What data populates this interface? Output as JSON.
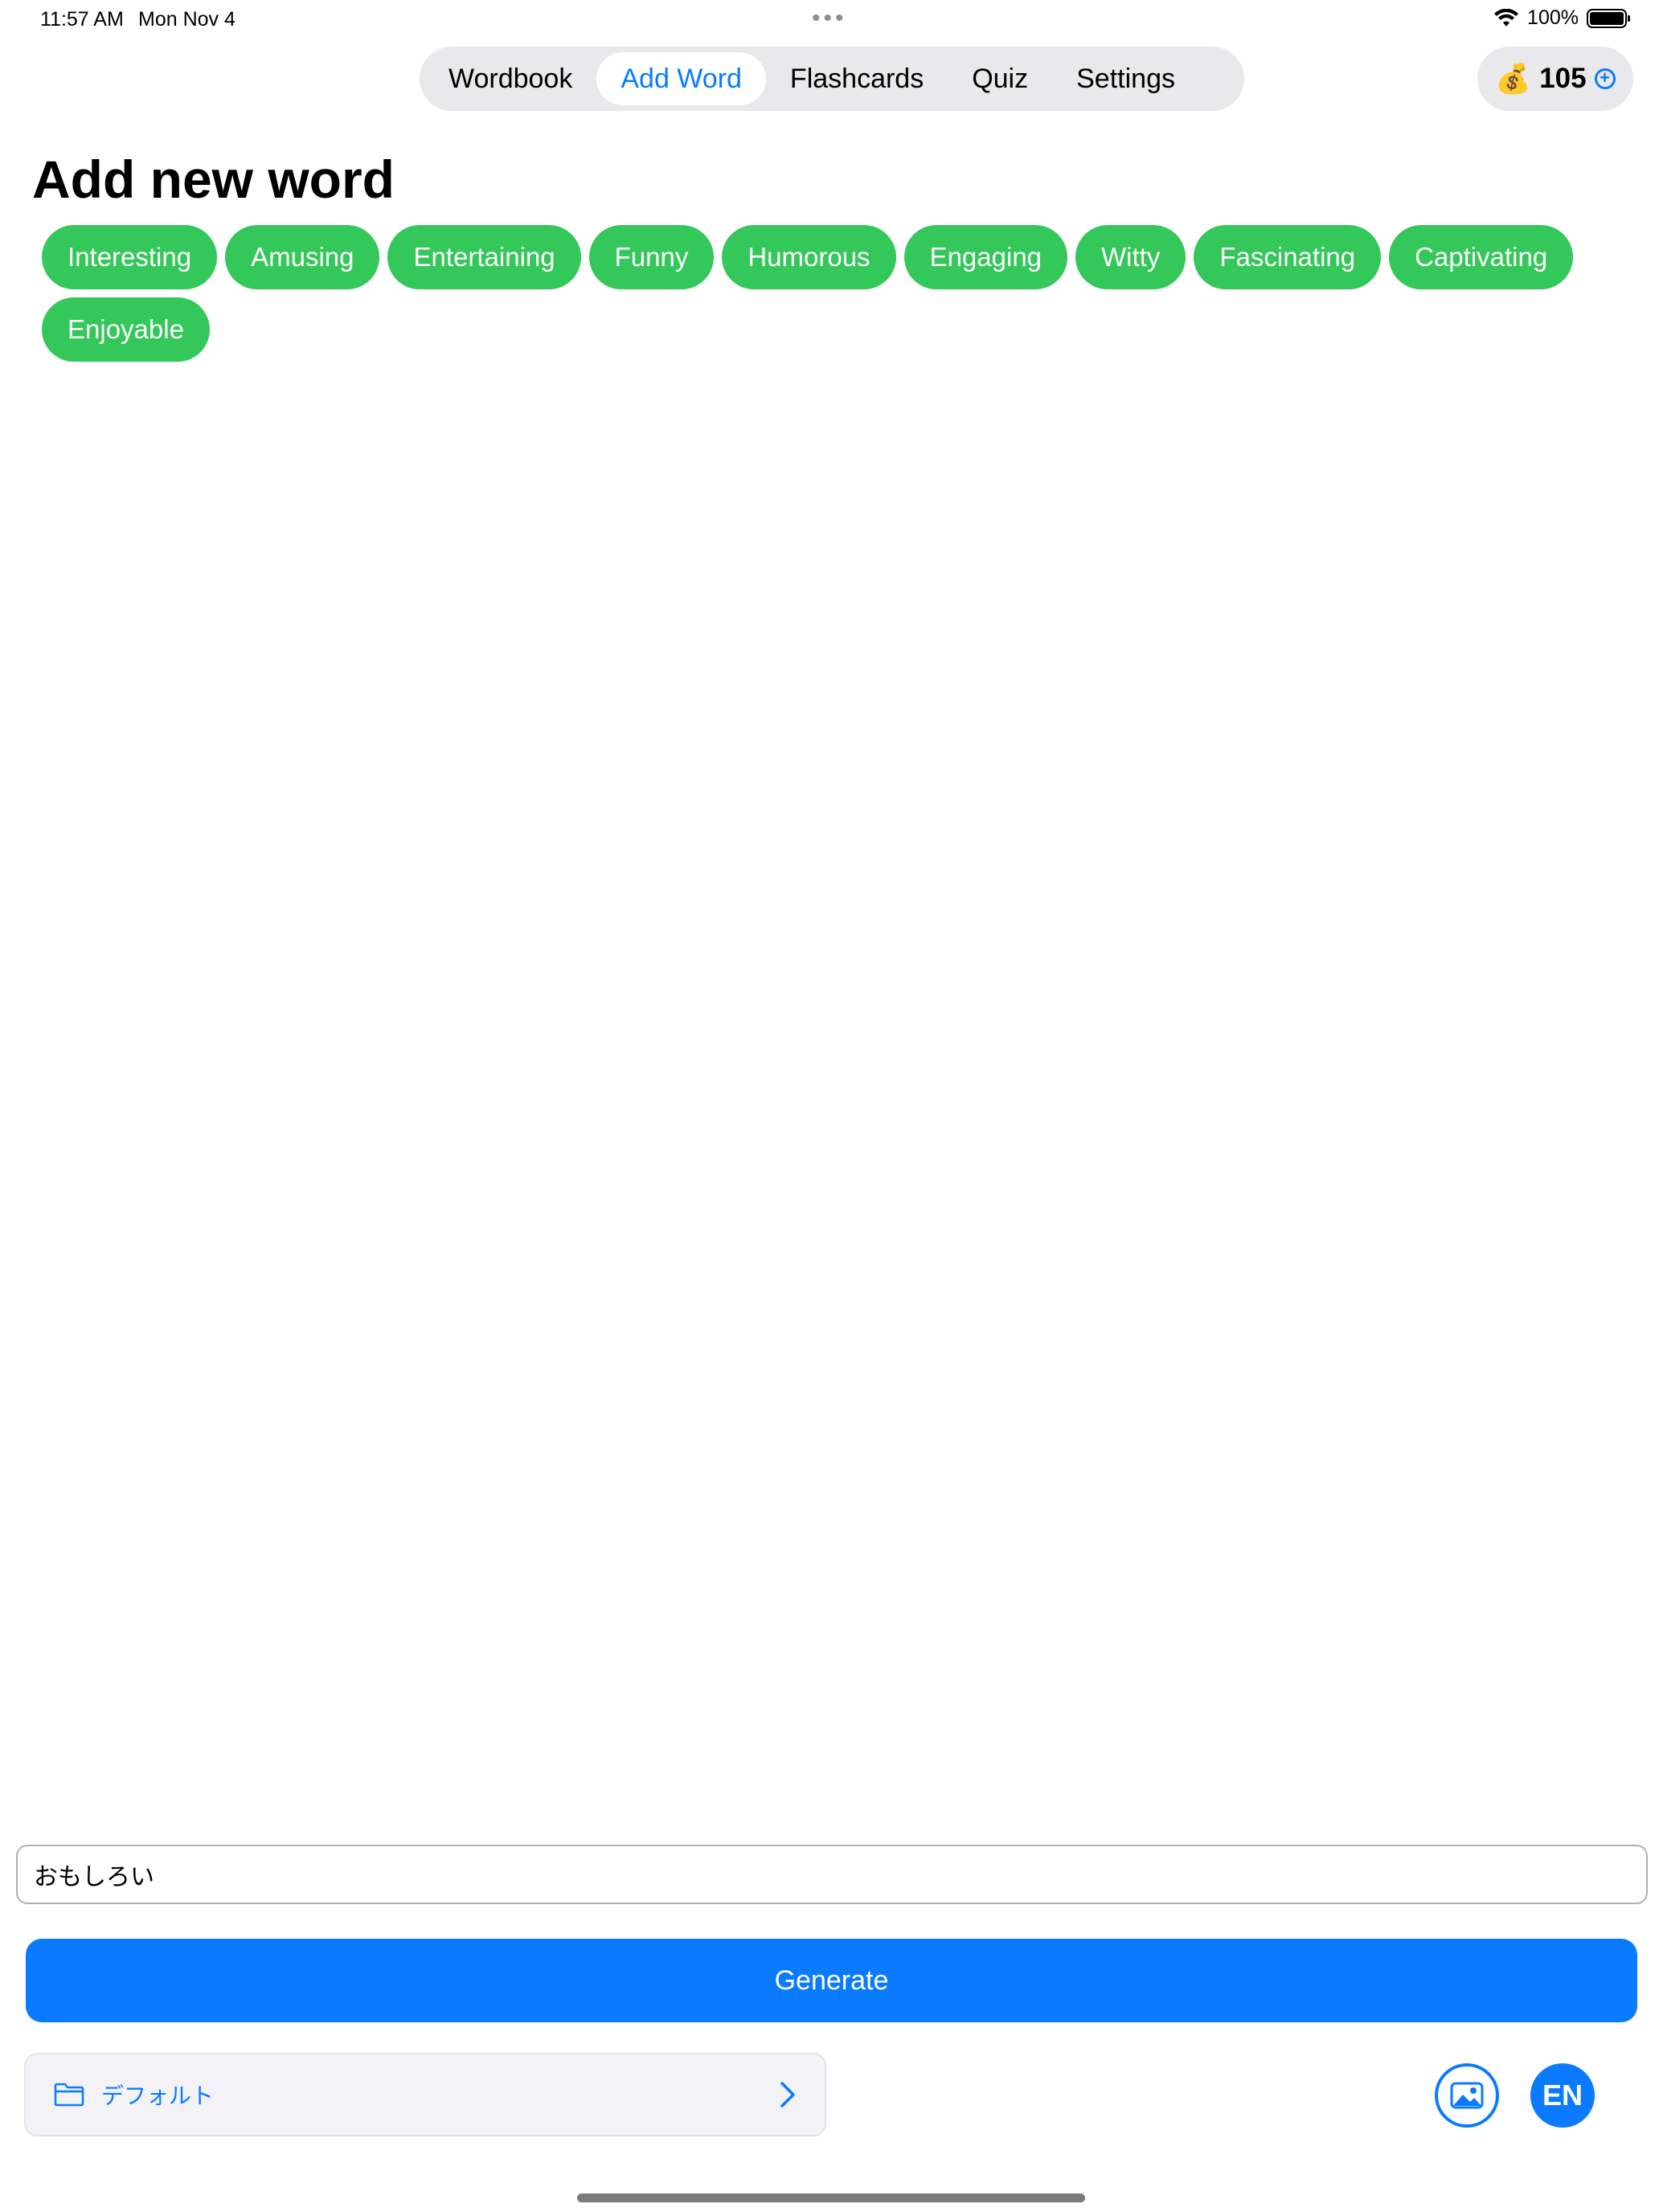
{
  "status_bar": {
    "time": "11:57 AM",
    "date": "Mon Nov 4",
    "multitask_dots": "•••",
    "battery": "100%"
  },
  "tabs": [
    {
      "label": "Wordbook",
      "active": false
    },
    {
      "label": "Add Word",
      "active": true
    },
    {
      "label": "Flashcards",
      "active": false
    },
    {
      "label": "Quiz",
      "active": false
    },
    {
      "label": "Settings",
      "active": false
    }
  ],
  "coins": {
    "icon": "money-bag-icon",
    "glyph": "💰",
    "count": "105",
    "add_icon": "plus-circle-icon"
  },
  "page": {
    "title": "Add new word"
  },
  "suggestions": [
    "Interesting",
    "Amusing",
    "Entertaining",
    "Funny",
    "Humorous",
    "Engaging",
    "Witty",
    "Fascinating",
    "Captivating",
    "Enjoyable"
  ],
  "input": {
    "value": "おもしろい"
  },
  "generate": {
    "label": "Generate"
  },
  "folder": {
    "label": "デフォルト"
  },
  "language": {
    "label": "EN"
  },
  "colors": {
    "accent": "#0a7bff",
    "chip": "#34c759"
  }
}
